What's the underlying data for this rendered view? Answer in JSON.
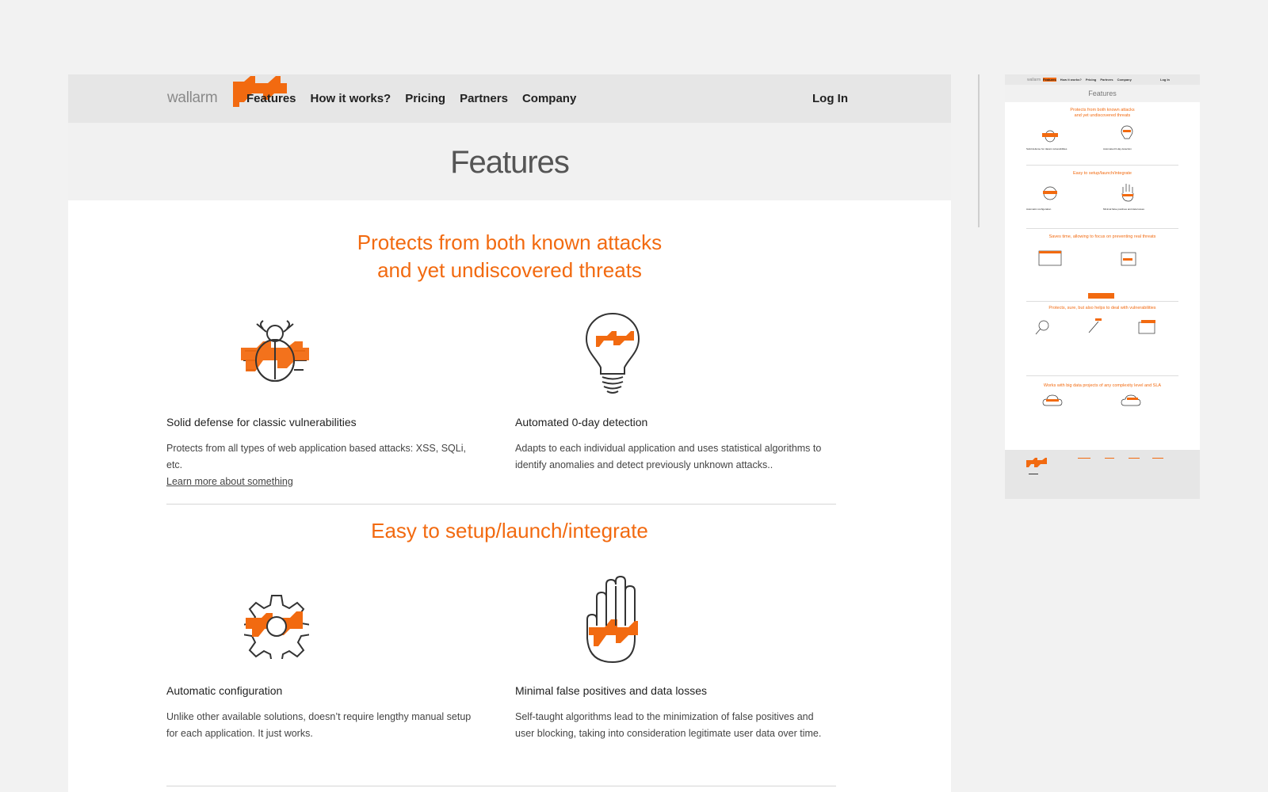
{
  "brand": {
    "logo_text": "wallarm",
    "accent": "#f26a10"
  },
  "nav": {
    "items": [
      {
        "label": "Features",
        "active": true
      },
      {
        "label": "How it works?"
      },
      {
        "label": "Pricing"
      },
      {
        "label": "Partners"
      },
      {
        "label": "Company"
      }
    ],
    "login": "Log In"
  },
  "page": {
    "title": "Features"
  },
  "sections": [
    {
      "title_line1": "Protects from both known attacks",
      "title_line2": "and yet undiscovered threats",
      "features": [
        {
          "icon": "bug-icon",
          "heading": "Solid defense for classic vulnerabilities",
          "text": "Protects from all types of web application based attacks: XSS, SQLi, etc.",
          "link": "Learn more about something"
        },
        {
          "icon": "lightbulb-icon",
          "heading": "Automated 0-day detection",
          "text": "Adapts to each individual application and uses statistical algorithms to identify anomalies and detect previously unknown attacks.."
        }
      ]
    },
    {
      "title": "Easy to setup/launch/integrate",
      "features": [
        {
          "icon": "gear-icon",
          "heading": "Automatic configuration",
          "text": "Unlike other available solutions, doesn’t require lengthy manual setup for each application. It just works."
        },
        {
          "icon": "hand-icon",
          "heading": "Minimal false positives and data losses",
          "text": "Self-taught algorithms lead to the minimization of false positives and user blocking, taking into consideration legitimate user data over time."
        }
      ]
    }
  ],
  "thumbnail": {
    "logo": "wallarm",
    "nav": [
      "Features",
      "How it works?",
      "Pricing",
      "Partners",
      "Company"
    ],
    "login": "Log In",
    "title": "Features",
    "section_titles": [
      "Protects from both known attacks",
      "and yet undiscovered threats",
      "Easy to setup/launch/integrate",
      "Saves time, allowing to focus on preventing real threats",
      "Protects, sure, but also helps to deal with vulnerabilities",
      "Works with big data projects of any complexity level and SLA"
    ]
  }
}
